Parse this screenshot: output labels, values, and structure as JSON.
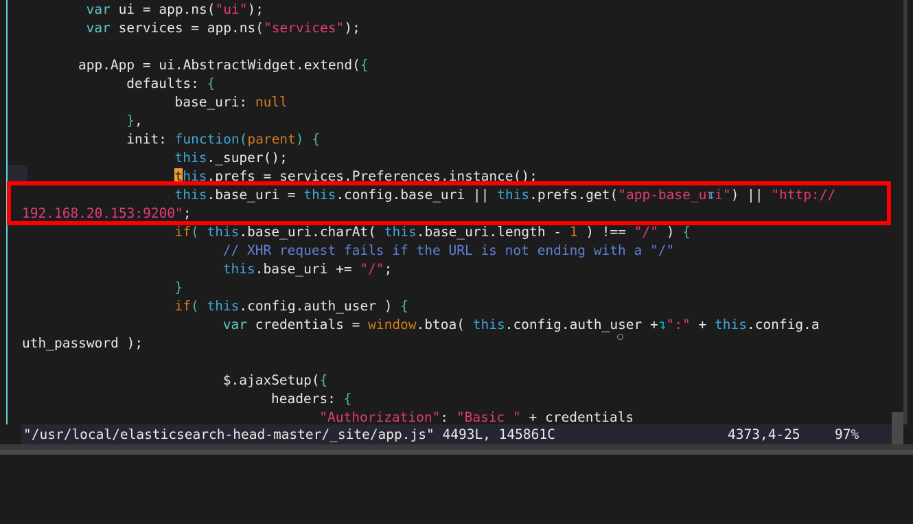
{
  "window": {
    "kind": "terminal-vim-editor",
    "border_color": "#5fd7d7",
    "background": "#1c1c1c"
  },
  "annotation": {
    "type": "red-rectangle-highlight",
    "color": "#ff0000",
    "target_text": "this.base_uri = this.config.base_uri || this.prefs.get(\"app-base_uri\") || \"http://192.168.20.153:9200\";"
  },
  "editor": {
    "cursor": {
      "char": "t",
      "color": "#f0a030"
    },
    "wrap_marker": "↴",
    "code_lines": [
      {
        "id": "l1",
        "indent": 8,
        "tokens": [
          {
            "t": "var",
            "c": "kw"
          },
          {
            "t": " ui = app.ns(",
            "c": "plain"
          },
          {
            "t": "\"ui\"",
            "c": "str"
          },
          {
            "t": ");",
            "c": "plain"
          }
        ]
      },
      {
        "id": "l2",
        "indent": 8,
        "tokens": [
          {
            "t": "var",
            "c": "kw"
          },
          {
            "t": " services = app.ns(",
            "c": "plain"
          },
          {
            "t": "\"services\"",
            "c": "str"
          },
          {
            "t": ");",
            "c": "plain"
          }
        ]
      },
      {
        "id": "l3",
        "indent": 0,
        "tokens": []
      },
      {
        "id": "l4",
        "indent": 7,
        "tokens": [
          {
            "t": "app.App = ui.AbstractWidget.extend(",
            "c": "plain"
          },
          {
            "t": "{",
            "c": "punct"
          }
        ]
      },
      {
        "id": "l5",
        "indent": 13,
        "tokens": [
          {
            "t": "defaults: ",
            "c": "plain"
          },
          {
            "t": "{",
            "c": "punct"
          }
        ]
      },
      {
        "id": "l6",
        "indent": 19,
        "tokens": [
          {
            "t": "base_uri: ",
            "c": "plain"
          },
          {
            "t": "null",
            "c": "kw2"
          }
        ]
      },
      {
        "id": "l7",
        "indent": 13,
        "tokens": [
          {
            "t": "}",
            "c": "punct"
          },
          {
            "t": ",",
            "c": "plain"
          }
        ]
      },
      {
        "id": "l8",
        "indent": 13,
        "tokens": [
          {
            "t": "init: ",
            "c": "plain"
          },
          {
            "t": "function",
            "c": "this"
          },
          {
            "t": "(",
            "c": "punct"
          },
          {
            "t": "parent",
            "c": "kw2"
          },
          {
            "t": ") ",
            "c": "punct"
          },
          {
            "t": "{",
            "c": "punct"
          }
        ]
      },
      {
        "id": "l9",
        "indent": 19,
        "tokens": [
          {
            "t": "this",
            "c": "this"
          },
          {
            "t": "._super();",
            "c": "plain"
          }
        ]
      },
      {
        "id": "l10",
        "indent": 19,
        "cursor_at": 0,
        "tokens": [
          {
            "t": "t",
            "c": "cursor"
          },
          {
            "t": "his",
            "c": "this"
          },
          {
            "t": ".prefs = services.Preferences.instance();",
            "c": "plain"
          }
        ]
      },
      {
        "id": "l11",
        "indent": 19,
        "wrapped": true,
        "tokens": [
          {
            "t": "this",
            "c": "this"
          },
          {
            "t": ".base_uri = ",
            "c": "plain"
          },
          {
            "t": "this",
            "c": "this"
          },
          {
            "t": ".config.base_uri || ",
            "c": "plain"
          },
          {
            "t": "this",
            "c": "this"
          },
          {
            "t": ".prefs.get(",
            "c": "plain"
          },
          {
            "t": "\"app-base_uri\"",
            "c": "str"
          },
          {
            "t": ") || ",
            "c": "plain"
          },
          {
            "t": "\"http:// ",
            "c": "str"
          }
        ]
      },
      {
        "id": "l11b",
        "indent": 0,
        "continuation": true,
        "tokens": [
          {
            "t": "192.168.20.153:9200\"",
            "c": "str"
          },
          {
            "t": ";",
            "c": "plain"
          }
        ]
      },
      {
        "id": "l12",
        "indent": 19,
        "tokens": [
          {
            "t": "if",
            "c": "kw2"
          },
          {
            "t": "( ",
            "c": "punct"
          },
          {
            "t": "this",
            "c": "this"
          },
          {
            "t": ".base_uri.charAt( ",
            "c": "plain"
          },
          {
            "t": "this",
            "c": "this"
          },
          {
            "t": ".base_uri.length - ",
            "c": "plain"
          },
          {
            "t": "1",
            "c": "kw2"
          },
          {
            "t": " ) !== ",
            "c": "plain"
          },
          {
            "t": "\"/\"",
            "c": "str"
          },
          {
            "t": " ) ",
            "c": "plain"
          },
          {
            "t": "{",
            "c": "punct"
          }
        ]
      },
      {
        "id": "l13",
        "indent": 25,
        "tokens": [
          {
            "t": "// XHR request fails if the URL is not ending with a \"/\"",
            "c": "cmt"
          }
        ]
      },
      {
        "id": "l14",
        "indent": 25,
        "tokens": [
          {
            "t": "this",
            "c": "this"
          },
          {
            "t": ".base_uri += ",
            "c": "plain"
          },
          {
            "t": "\"/\"",
            "c": "str"
          },
          {
            "t": ";",
            "c": "plain"
          }
        ]
      },
      {
        "id": "l15",
        "indent": 19,
        "tokens": [
          {
            "t": "}",
            "c": "punct"
          }
        ]
      },
      {
        "id": "l16",
        "indent": 19,
        "tokens": [
          {
            "t": "if",
            "c": "kw2"
          },
          {
            "t": "( ",
            "c": "punct"
          },
          {
            "t": "this",
            "c": "this"
          },
          {
            "t": ".config.auth_user ) ",
            "c": "plain"
          },
          {
            "t": "{",
            "c": "punct"
          }
        ]
      },
      {
        "id": "l17",
        "indent": 25,
        "wrapped2": true,
        "tokens": [
          {
            "t": "var",
            "c": "kw"
          },
          {
            "t": " credentials = ",
            "c": "plain"
          },
          {
            "t": "window",
            "c": "kw2"
          },
          {
            "t": ".btoa( ",
            "c": "plain"
          },
          {
            "t": "this",
            "c": "this"
          },
          {
            "t": ".config.auth_user + ",
            "c": "plain"
          },
          {
            "t": "\":\"",
            "c": "str"
          },
          {
            "t": " + ",
            "c": "plain"
          },
          {
            "t": "this",
            "c": "this"
          },
          {
            "t": ".config.a ",
            "c": "plain"
          }
        ]
      },
      {
        "id": "l17b",
        "indent": 0,
        "continuation": true,
        "tokens": [
          {
            "t": "uth_password );",
            "c": "plain"
          }
        ]
      },
      {
        "id": "l18",
        "indent": 0,
        "tokens": []
      },
      {
        "id": "l19",
        "indent": 25,
        "tokens": [
          {
            "t": "$.ajaxSetup(",
            "c": "plain"
          },
          {
            "t": "{",
            "c": "punct"
          }
        ]
      },
      {
        "id": "l20",
        "indent": 31,
        "tokens": [
          {
            "t": "headers: ",
            "c": "plain"
          },
          {
            "t": "{",
            "c": "punct"
          }
        ]
      },
      {
        "id": "l21",
        "indent": 37,
        "tokens": [
          {
            "t": "\"Authorization\"",
            "c": "str"
          },
          {
            "t": ": ",
            "c": "plain"
          },
          {
            "t": "\"Basic \"",
            "c": "str"
          },
          {
            "t": " + credentials",
            "c": "plain"
          }
        ]
      },
      {
        "id": "l22",
        "indent": 31,
        "tokens": [
          {
            "t": "}",
            "c": "punct"
          }
        ]
      }
    ]
  },
  "statusline": {
    "file": "\"/usr/local/elasticsearch-head-master/_site/app.js\" 4493L, 145861C",
    "ruler": "4373,4-25",
    "percent": "97%"
  }
}
